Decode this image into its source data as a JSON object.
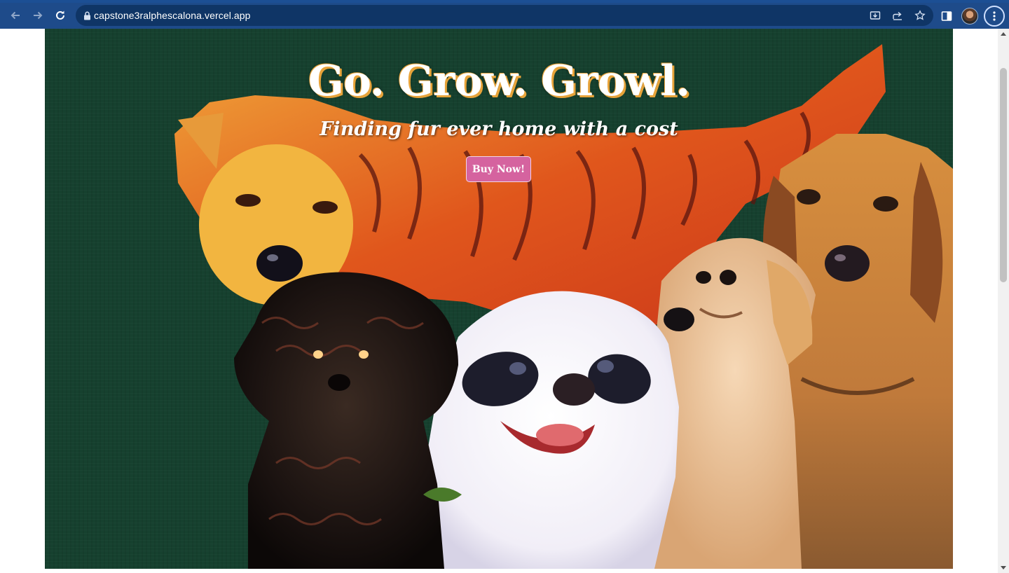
{
  "browser": {
    "url": "capstone3ralphescalona.vercel.app",
    "accent_color": "#1e4b8a"
  },
  "icons": {
    "back": "back-arrow-icon",
    "forward": "forward-arrow-icon",
    "reload": "reload-icon",
    "lock": "lock-icon",
    "install": "install-app-icon",
    "share": "share-icon",
    "bookmark": "star-icon",
    "side_panel": "side-panel-icon",
    "profile": "avatar",
    "menu": "kebab-menu-icon"
  },
  "hero": {
    "title": "Go. Grow. Growl.",
    "subtitle": "Finding fur ever home with a cost",
    "cta_label": "Buy Now!",
    "background_color": "#16412f",
    "title_shadow_color": "#e7a33a",
    "cta_color": "#d5639f"
  }
}
